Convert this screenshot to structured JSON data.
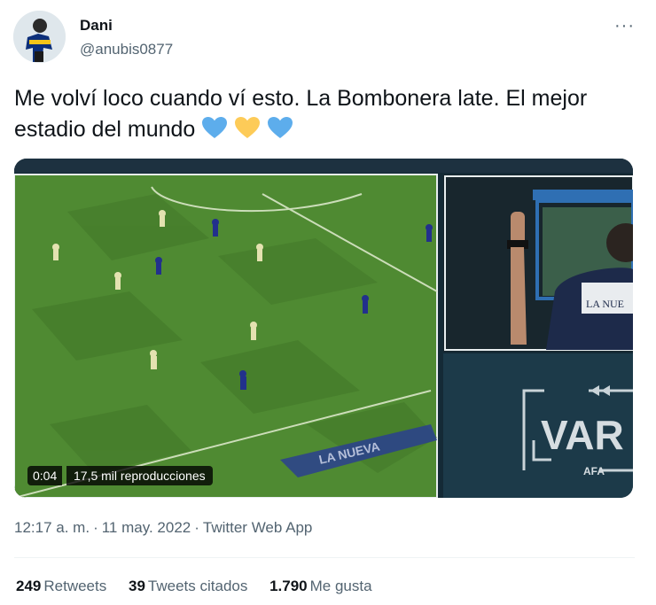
{
  "tweet": {
    "author_name": "Dani",
    "author_handle": "@anubis0877",
    "text": "Me volví loco cuando ví esto. La Bombonera late. El mejor estadio del mundo",
    "emoji": [
      "blue-heart",
      "yellow-heart",
      "blue-heart"
    ],
    "more_icon": "more-horizontal-icon",
    "timestamp": "12:17 a. m.",
    "date": "11 may. 2022",
    "source": "Twitter Web App",
    "separator": "·"
  },
  "video": {
    "elapsed": "0:04",
    "views": "17,5 mil reproducciones",
    "overlay_text": "VAR",
    "sub_logo": "AFA",
    "jersey_text": "LA NUE"
  },
  "stats": {
    "retweets_count": "249",
    "retweets_label": "Retweets",
    "quotes_count": "39",
    "quotes_label": "Tweets citados",
    "likes_count": "1.790",
    "likes_label": "Me gusta"
  },
  "colors": {
    "text": "#0f1419",
    "secondary": "#536471",
    "blue_heart": "#5dadec",
    "yellow_heart": "#fdcb58",
    "pitch": "#4f8a32",
    "var_panel": "#1c3a49"
  }
}
